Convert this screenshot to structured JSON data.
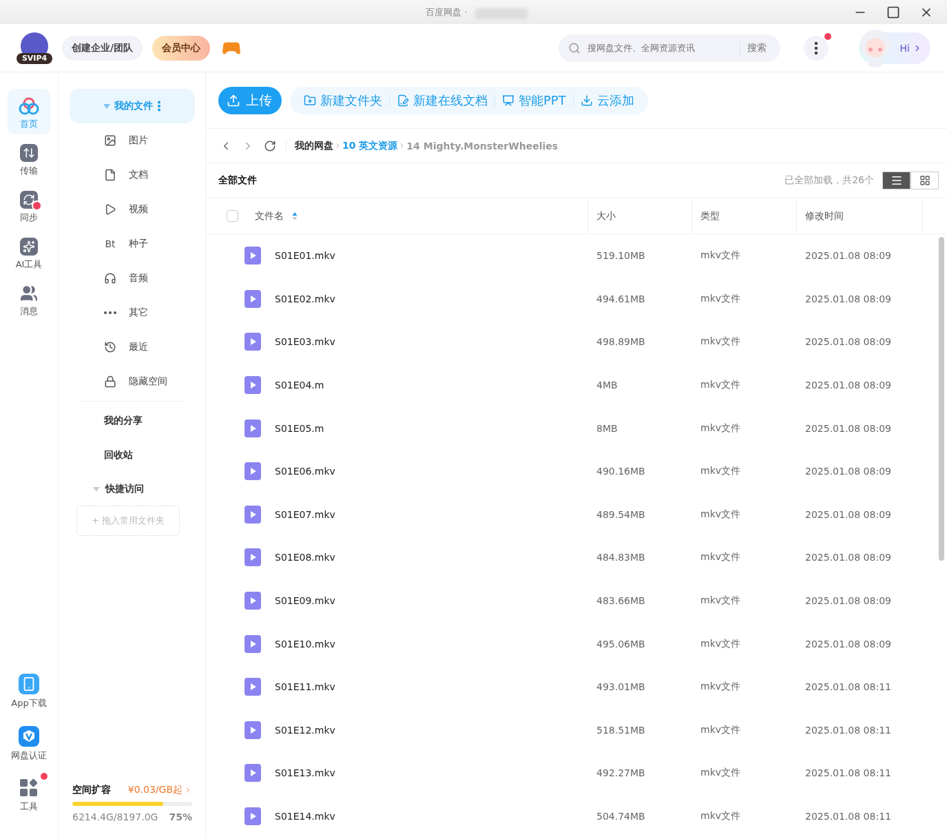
{
  "window": {
    "title": "百度网盘 ·"
  },
  "header": {
    "badge": "SVIP4",
    "buttons": [
      {
        "label": "创建企业/团队",
        "kind": "plain"
      },
      {
        "label": "会员中心",
        "kind": "vip"
      }
    ],
    "search": {
      "placeholder": "搜网盘文件、全网资源资讯",
      "button": "搜索"
    },
    "more_dot": true,
    "greeting": "Hi"
  },
  "rail": {
    "items": [
      {
        "label": "首页",
        "selected": true
      },
      {
        "label": "传输",
        "selected": false
      },
      {
        "label": "同步",
        "selected": false
      },
      {
        "label": "AI工具",
        "selected": false
      },
      {
        "label": "消息",
        "selected": false
      }
    ],
    "bottom": [
      {
        "label": "App下载",
        "dot": false
      },
      {
        "label": "网盘认证",
        "dot": false
      },
      {
        "label": "工具",
        "dot": true
      }
    ]
  },
  "sidebar": {
    "root": {
      "label": "我的文件",
      "expanded": true,
      "selected": true
    },
    "categories": [
      {
        "label": "图片"
      },
      {
        "label": "文档"
      },
      {
        "label": "视频"
      },
      {
        "label": "种子",
        "glyph": "Bt"
      },
      {
        "label": "音频"
      },
      {
        "label": "其它"
      },
      {
        "label": "最近"
      },
      {
        "label": "隐藏空间"
      }
    ],
    "links": [
      "我的分享",
      "回收站"
    ],
    "quick": {
      "label": "快捷访问",
      "expanded": true,
      "drop_hint": "+ 拖入常用文件夹"
    },
    "storage": {
      "title": "空间扩容",
      "offer": "¥0.03/GB起",
      "usage": "6214.4G/8197.0G",
      "percent": "75%",
      "level": 0.758
    }
  },
  "toolbar": {
    "upload": "上传",
    "actions": [
      "新建文件夹",
      "新建在线文档",
      "智能PPT",
      "云添加"
    ]
  },
  "breadcrumb": [
    {
      "label": "我的网盘",
      "kind": "root"
    },
    {
      "label": "10 英文资源",
      "kind": "link"
    },
    {
      "label": "14 Mighty.MonsterWheelies",
      "kind": "current"
    }
  ],
  "list": {
    "title": "全部文件",
    "status": "已全部加载，共26个",
    "views": [
      {
        "selected": true
      },
      {
        "selected": false
      }
    ],
    "select_all": {
      "checked": false
    },
    "columns": [
      "文件名",
      "大小",
      "类型",
      "修改时间"
    ],
    "rows": [
      {
        "name": "S01E01.mkv",
        "size": "519.10MB",
        "type": "mkv文件",
        "modified": "2025.01.08 08:09",
        "selected": false
      },
      {
        "name": "S01E02.mkv",
        "size": "494.61MB",
        "type": "mkv文件",
        "modified": "2025.01.08 08:09",
        "selected": false
      },
      {
        "name": "S01E03.mkv",
        "size": "498.89MB",
        "type": "mkv文件",
        "modified": "2025.01.08 08:09",
        "selected": false
      },
      {
        "name": "S01E04.m",
        "size": "4MB",
        "type": "mkv文件",
        "modified": "2025.01.08 08:09",
        "selected": false
      },
      {
        "name": "S01E05.m",
        "size": "8MB",
        "type": "mkv文件",
        "modified": "2025.01.08 08:09",
        "selected": false
      },
      {
        "name": "S01E06.mkv",
        "size": "490.16MB",
        "type": "mkv文件",
        "modified": "2025.01.08 08:09",
        "selected": false
      },
      {
        "name": "S01E07.mkv",
        "size": "489.54MB",
        "type": "mkv文件",
        "modified": "2025.01.08 08:09",
        "selected": false
      },
      {
        "name": "S01E08.mkv",
        "size": "484.83MB",
        "type": "mkv文件",
        "modified": "2025.01.08 08:09",
        "selected": false
      },
      {
        "name": "S01E09.mkv",
        "size": "483.66MB",
        "type": "mkv文件",
        "modified": "2025.01.08 08:09",
        "selected": false
      },
      {
        "name": "S01E10.mkv",
        "size": "495.06MB",
        "type": "mkv文件",
        "modified": "2025.01.08 08:09",
        "selected": false
      },
      {
        "name": "S01E11.mkv",
        "size": "493.01MB",
        "type": "mkv文件",
        "modified": "2025.01.08 08:11",
        "selected": false
      },
      {
        "name": "S01E12.mkv",
        "size": "518.51MB",
        "type": "mkv文件",
        "modified": "2025.01.08 08:11",
        "selected": false
      },
      {
        "name": "S01E13.mkv",
        "size": "492.27MB",
        "type": "mkv文件",
        "modified": "2025.01.08 08:11",
        "selected": false
      },
      {
        "name": "S01E14.mkv",
        "size": "504.74MB",
        "type": "mkv文件",
        "modified": "2025.01.08 08:11",
        "selected": false
      }
    ]
  }
}
